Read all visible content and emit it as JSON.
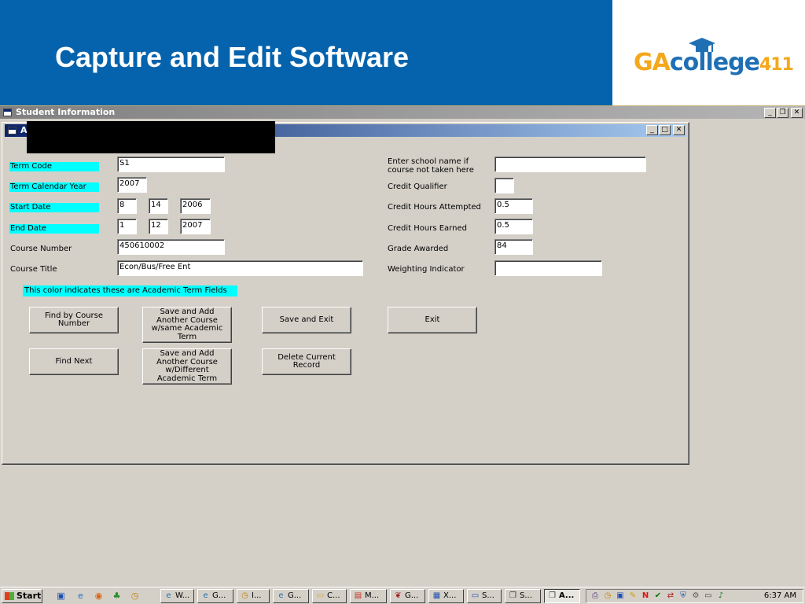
{
  "slide": {
    "title": "Capture and Edit Software",
    "logo": {
      "ga": "GA",
      "college": "college",
      "num": "411"
    }
  },
  "outer_window": {
    "title": "Student Information",
    "controls": {
      "minimize": "_",
      "restore": "❐",
      "close": "✕"
    }
  },
  "child_window": {
    "title": "A",
    "controls": {
      "minimize": "_",
      "maximize": "□",
      "close": "✕"
    }
  },
  "form": {
    "term_code": {
      "label": "Term Code",
      "value": "S1"
    },
    "term_calendar_year": {
      "label": "Term Calendar Year",
      "value": "2007"
    },
    "start_date": {
      "label": "Start Date",
      "month": "8",
      "day": "14",
      "year": "2006"
    },
    "end_date": {
      "label": "End Date",
      "month": "1",
      "day": "12",
      "year": "2007"
    },
    "course_number": {
      "label": "Course Number",
      "value": "450610002"
    },
    "course_title": {
      "label": "Course Title",
      "value": "Econ/Bus/Free Ent"
    },
    "school_name": {
      "label_line1": "Enter school name if",
      "label_line2": "course not taken here",
      "value": ""
    },
    "credit_qualifier": {
      "label": "Credit Qualifier",
      "value": ""
    },
    "credit_hours_attempted": {
      "label": "Credit Hours Attempted",
      "value": "0.5"
    },
    "credit_hours_earned": {
      "label": "Credit Hours Earned",
      "value": "0.5"
    },
    "grade_awarded": {
      "label": "Grade Awarded",
      "value": "84"
    },
    "weighting_indicator": {
      "label": "Weighting Indicator",
      "value": ""
    },
    "legend_note": "This color indicates these are Academic Term Fields"
  },
  "buttons": {
    "find_by_course_number": "Find by Course Number",
    "save_add_same_term": "Save and Add Another Course w/same Academic Term",
    "save_and_exit": "Save and Exit",
    "exit": "Exit",
    "find_next": "Find Next",
    "save_add_different_term": "Save and Add Another Course w/Different Academic Term",
    "delete_current_record": "Delete Current Record"
  },
  "taskbar": {
    "start_label": "Start",
    "tasks": [
      "W...",
      "G...",
      "I...",
      "G...",
      "C...",
      "M...",
      "G...",
      "X...",
      "S...",
      "S...",
      "A..."
    ],
    "clock": "6:37 AM"
  },
  "colors": {
    "header_blue": "#0563ad",
    "term_field_highlight": "#00ffff",
    "window_face": "#d4d0c8"
  }
}
